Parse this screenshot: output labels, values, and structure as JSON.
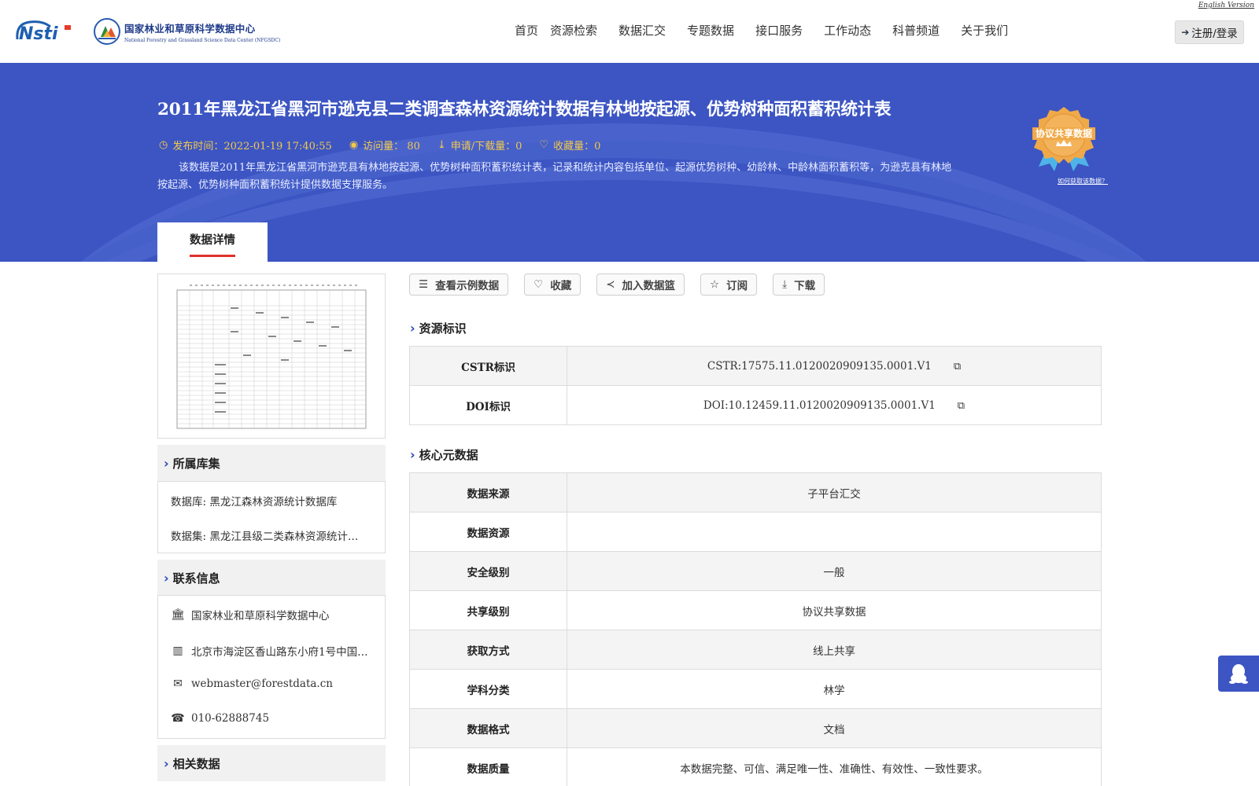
{
  "header": {
    "english_link": "English Version",
    "nsti_logo_text": "Nsti",
    "center_name_cn": "国家林业和草原科学数据中心",
    "center_name_en": "National Forestry and Grassland Science Data Center (NFGSDC)",
    "nav": [
      "首页",
      "资源检索",
      "数据汇交",
      "专题数据",
      "接口服务",
      "工作动态",
      "科普频道",
      "关于我们"
    ],
    "login_label": "注册/登录"
  },
  "banner": {
    "title": "2011年黑龙江省黑河市逊克县二类调查森林资源统计数据有林地按起源、优势树种面积蓄积统计表",
    "publish": "发布时间：2022-01-19 17:40:55",
    "visits": "访问量： 80",
    "downloads": "申请/下载量：0",
    "favorites": "收藏量：0",
    "description": "该数据是2011年黑龙江省黑河市逊克县有林地按起源、优势树种面积蓄积统计表，记录和统计内容包括单位、起源优势树种、幼龄林、中龄林面积蓄积等，为逊克县有林地按起源、优势树种面积蓄积统计提供数据支撑服务。",
    "badge_text": "协议共享数据",
    "badge_link": "如何获取该数据？",
    "tab_label": "数据详情"
  },
  "actions": [
    "查看示例数据",
    "收藏",
    "加入数据篮",
    "订阅",
    "下载"
  ],
  "left": {
    "collection_heading": "所属库集",
    "database": "数据库: 黑龙江森林资源统计数据库",
    "dataset": "数据集: 黑龙江县级二类森林资源统计…",
    "contact_heading": "联系信息",
    "org": "国家林业和草原科学数据中心",
    "address": "北京市海淀区香山路东小府1号中国…",
    "email": "webmaster@forestdata.cn",
    "phone": "010-62888745",
    "related_heading": "相关数据"
  },
  "resource_id": {
    "heading": "资源标识",
    "rows": [
      {
        "key": "CSTR标识",
        "value": "CSTR:17575.11.0120020909135.0001.V1"
      },
      {
        "key": "DOI标识",
        "value": "DOI:10.12459.11.0120020909135.0001.V1"
      }
    ]
  },
  "core_meta": {
    "heading": "核心元数据",
    "rows": [
      {
        "key": "数据来源",
        "value": "子平台汇交"
      },
      {
        "key": "数据资源",
        "value": ""
      },
      {
        "key": "安全级别",
        "value": "一般"
      },
      {
        "key": "共享级别",
        "value": "协议共享数据"
      },
      {
        "key": "获取方式",
        "value": "线上共享"
      },
      {
        "key": "学科分类",
        "value": "林学"
      },
      {
        "key": "数据格式",
        "value": "文档"
      },
      {
        "key": "数据质量",
        "value": "本数据完整、可信、满足唯一性、准确性、有效性、一致性要求。"
      }
    ]
  },
  "colors": {
    "banner": "#3c55c3",
    "accent": "#f2c94c",
    "tab_underline": "#e0302a"
  }
}
